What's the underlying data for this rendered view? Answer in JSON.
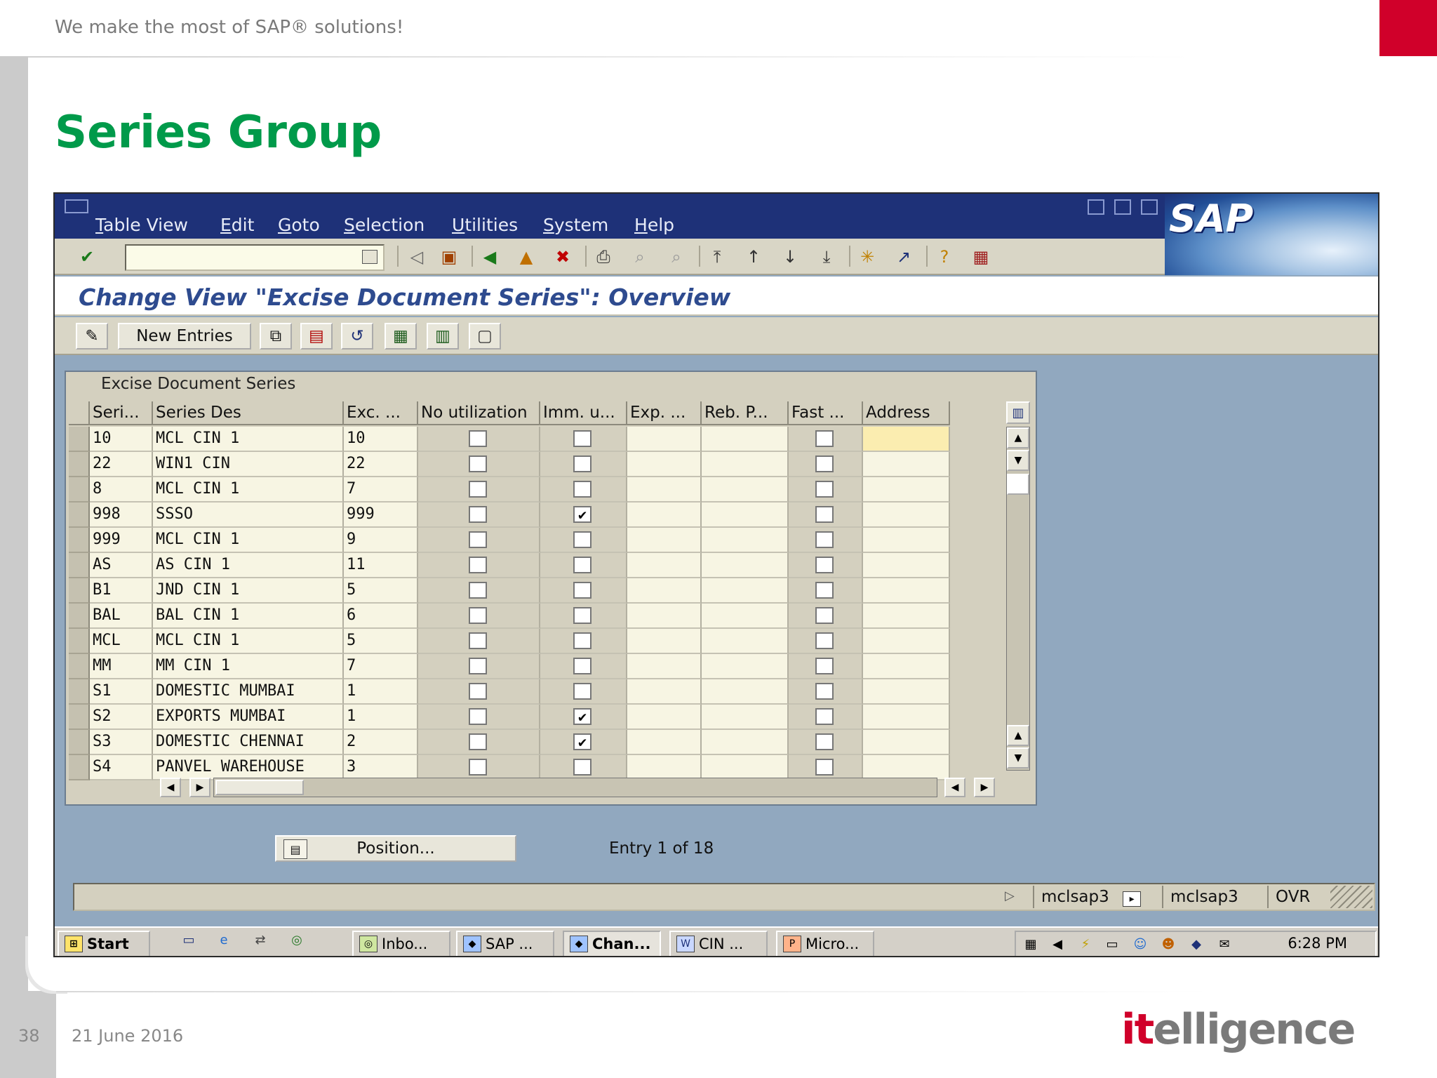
{
  "slide": {
    "tagline": "We make the most of SAP® solutions!",
    "title": "Series Group",
    "page_number": "38",
    "date": "21 June 2016",
    "logo_prefix": "it",
    "logo_suffix": "elligence",
    "accent_color": "#d0002a",
    "title_color": "#009a4a"
  },
  "sap": {
    "menu": [
      "Table View",
      "Edit",
      "Goto",
      "Selection",
      "Utilities",
      "System",
      "Help"
    ],
    "logo_text": "SAP",
    "screen_title": "Change View \"Excise Document Series\": Overview",
    "new_entries_label": "New Entries",
    "table_caption": "Excise Document Series",
    "columns": [
      "Seri...",
      "Series Des",
      "Exc. ...",
      "No utilization",
      "Imm. u...",
      "Exp. ...",
      "Reb. P...",
      "Fast ...",
      "Address"
    ],
    "rows": [
      {
        "seri": "10",
        "desc": "MCL CIN 1",
        "exc": "10",
        "no_util": false,
        "imm": false,
        "fast": false
      },
      {
        "seri": "22",
        "desc": "WIN1 CIN",
        "exc": "22",
        "no_util": false,
        "imm": false,
        "fast": false
      },
      {
        "seri": "8",
        "desc": "MCL CIN 1",
        "exc": "7",
        "no_util": false,
        "imm": false,
        "fast": false
      },
      {
        "seri": "998",
        "desc": "SSSO",
        "exc": "999",
        "no_util": false,
        "imm": true,
        "fast": false
      },
      {
        "seri": "999",
        "desc": "MCL CIN 1",
        "exc": "9",
        "no_util": false,
        "imm": false,
        "fast": false
      },
      {
        "seri": "AS",
        "desc": "AS CIN 1",
        "exc": "11",
        "no_util": false,
        "imm": false,
        "fast": false
      },
      {
        "seri": "B1",
        "desc": "JND CIN 1",
        "exc": "5",
        "no_util": false,
        "imm": false,
        "fast": false
      },
      {
        "seri": "BAL",
        "desc": "BAL CIN 1",
        "exc": "6",
        "no_util": false,
        "imm": false,
        "fast": false
      },
      {
        "seri": "MCL",
        "desc": "MCL CIN 1",
        "exc": "5",
        "no_util": false,
        "imm": false,
        "fast": false
      },
      {
        "seri": "MM",
        "desc": "MM CIN 1",
        "exc": "7",
        "no_util": false,
        "imm": false,
        "fast": false
      },
      {
        "seri": "S1",
        "desc": "DOMESTIC MUMBAI",
        "exc": "1",
        "no_util": false,
        "imm": false,
        "fast": false
      },
      {
        "seri": "S2",
        "desc": "EXPORTS MUMBAI",
        "exc": "1",
        "no_util": false,
        "imm": true,
        "fast": false
      },
      {
        "seri": "S3",
        "desc": "DOMESTIC CHENNAI",
        "exc": "2",
        "no_util": false,
        "imm": true,
        "fast": false
      },
      {
        "seri": "S4",
        "desc": "PANVEL WAREHOUSE",
        "exc": "3",
        "no_util": false,
        "imm": false,
        "fast": false
      }
    ],
    "position_label": "Position...",
    "entry_text": "Entry 1 of 18",
    "status": {
      "system": "mclsap3",
      "client": "mclsap3",
      "mode": "OVR"
    }
  },
  "taskbar": {
    "start_label": "Start",
    "items": [
      {
        "label": "Inbo...",
        "active": false
      },
      {
        "label": "SAP ...",
        "active": false
      },
      {
        "label": "Chan...",
        "active": true
      },
      {
        "label": "CIN ...",
        "active": false
      },
      {
        "label": "Micro...",
        "active": false
      }
    ],
    "clock": "6:28 PM"
  }
}
